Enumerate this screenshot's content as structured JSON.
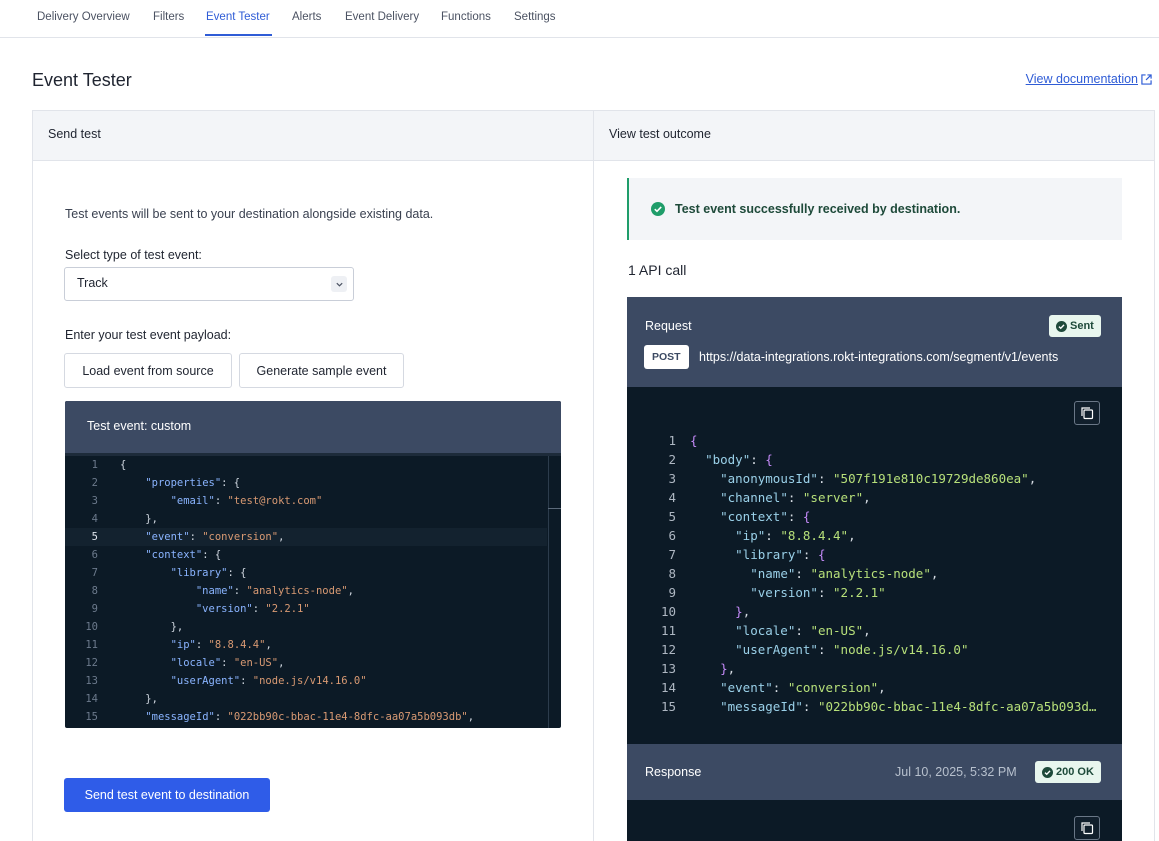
{
  "tabs": [
    "Delivery Overview",
    "Filters",
    "Event Tester",
    "Alerts",
    "Event Delivery",
    "Functions",
    "Settings"
  ],
  "active_tab": "Event Tester",
  "page": {
    "title": "Event Tester",
    "doc_link": "View documentation"
  },
  "send": {
    "header": "Send test",
    "intro": "Test events will be sent to your destination alongside existing data.",
    "select_label": "Select type of test event:",
    "select_value": "Track",
    "payload_label": "Enter your test event payload:",
    "load_button": "Load event from source",
    "generate_button": "Generate sample event",
    "editor_title": "Test event: custom",
    "submit_button": "Send test event to destination"
  },
  "outcome": {
    "header": "View test outcome",
    "success_message": "Test event successfully received by destination.",
    "api_calls": "1 API call",
    "request_title": "Request",
    "sent_badge": "Sent",
    "method": "POST",
    "url": "https://data-integrations.rokt-integrations.com/segment/v1/events",
    "response_title": "Response",
    "response_time": "Jul 10, 2025, 5:32 PM",
    "status_badge": "200 OK"
  },
  "colors": {
    "accent": "#2f5cd6",
    "primary_button": "#2f5ce8",
    "success": "#1f9d6a",
    "code_bg": "#0c1a26",
    "card_header": "#3c4a63"
  }
}
